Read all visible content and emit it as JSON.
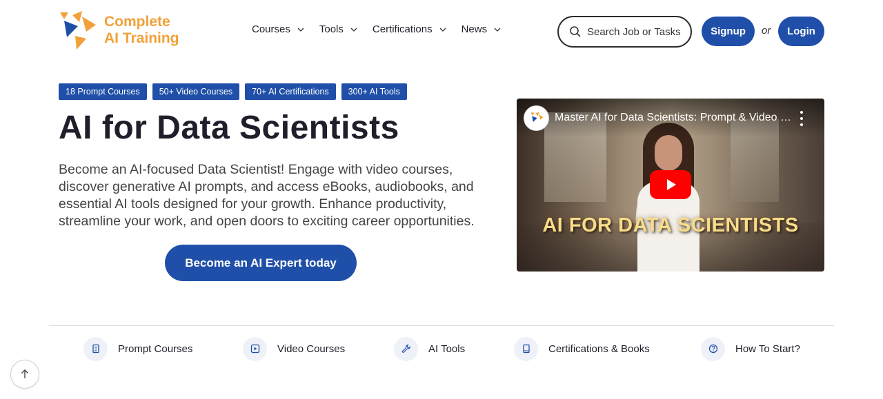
{
  "header": {
    "logo": {
      "line1": "Complete",
      "line2": "AI Training"
    },
    "nav": [
      {
        "label": "Courses"
      },
      {
        "label": "Tools"
      },
      {
        "label": "Certifications"
      },
      {
        "label": "News"
      }
    ],
    "search": {
      "placeholder": "Search Job or Tasks"
    },
    "signup_label": "Signup",
    "or_label": "or",
    "login_label": "Login"
  },
  "hero": {
    "badges": [
      "18 Prompt Courses",
      "50+ Video Courses",
      "70+ AI Certifications",
      "300+ AI Tools"
    ],
    "title": "AI for Data Scientists",
    "description": "Become an AI-focused Data Scientist! Engage with video courses, discover generative AI prompts, and access eBooks, audiobooks, and essential AI tools designed for your growth. Enhance productivity, streamline your work, and open doors to exciting career opportunities.",
    "cta_label": "Become an AI Expert today"
  },
  "video": {
    "title": "Master AI for Data Scientists: Prompt & Video Courses, AI Tools & Certifications",
    "caption": "AI FOR DATA SCIENTISTS"
  },
  "categories": [
    {
      "label": "Prompt Courses",
      "icon": "document-icon"
    },
    {
      "label": "Video Courses",
      "icon": "play-square-icon"
    },
    {
      "label": "AI Tools",
      "icon": "wrench-icon"
    },
    {
      "label": "Certifications & Books",
      "icon": "book-icon"
    },
    {
      "label": "How To Start?",
      "icon": "question-icon"
    }
  ],
  "colors": {
    "brand_blue": "#1f4fa8",
    "logo_orange": "#f2a13a",
    "play_red": "#ff0000"
  }
}
